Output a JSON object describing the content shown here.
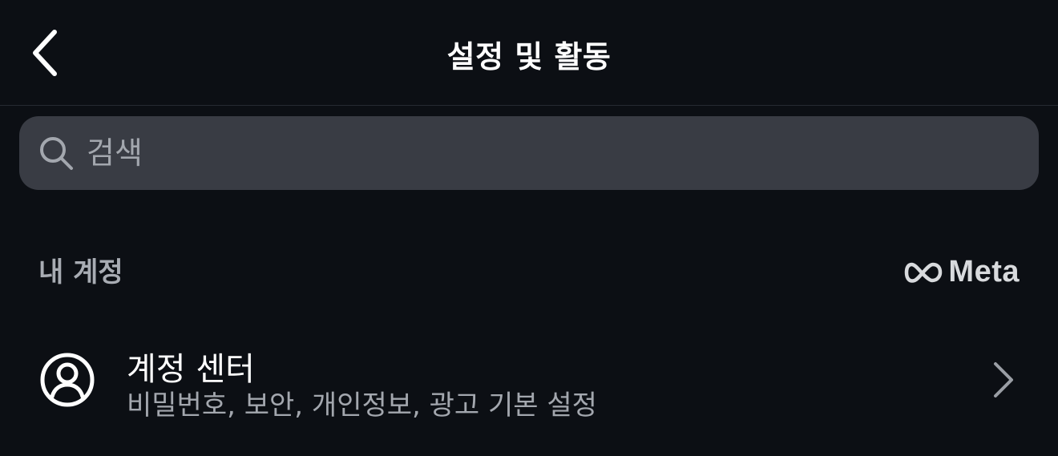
{
  "header": {
    "title": "설정 및 활동",
    "back_icon": "chevron-left-icon"
  },
  "search": {
    "placeholder": "검색",
    "value": "",
    "icon": "search-icon"
  },
  "section": {
    "title": "내 계정",
    "brand": "Meta",
    "brand_icon": "meta-infinity-icon"
  },
  "items": [
    {
      "title": "계정 센터",
      "subtitle": "비밀번호, 보안, 개인정보, 광고 기본 설정",
      "icon": "account-circle-icon",
      "trailing_icon": "chevron-right-icon"
    }
  ],
  "colors": {
    "background": "#0c0f14",
    "search_bg": "#393c44",
    "secondary_text": "#a3a7ae",
    "divider": "#262a31"
  }
}
